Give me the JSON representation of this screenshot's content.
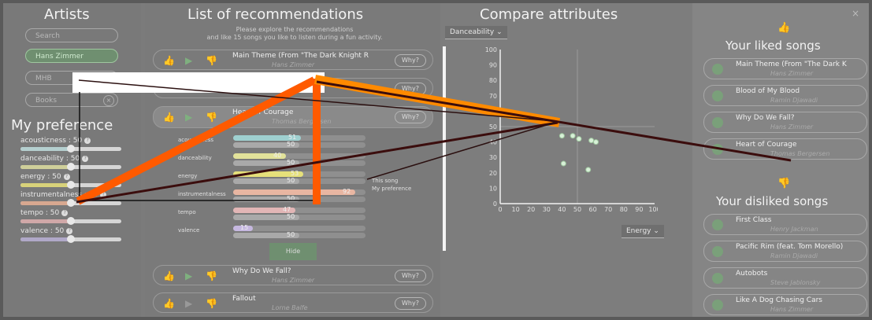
{
  "artists": {
    "title": "Artists",
    "search_placeholder": "Search",
    "items": [
      {
        "label": "Hans Zimmer",
        "selected": true
      },
      {
        "label": "MHB",
        "selected": false
      },
      {
        "label": "Books",
        "selected": false
      }
    ],
    "close_symbol": "×"
  },
  "preference": {
    "title": "My preference",
    "sliders": [
      {
        "label": "acousticness : 50",
        "value": 50,
        "color": "#b5cfcf"
      },
      {
        "label": "danceability : 50",
        "value": 50,
        "color": "#cfcf9a"
      },
      {
        "label": "energy : 50",
        "value": 50,
        "color": "#d8d27a"
      },
      {
        "label": "instrumentalness : 50",
        "value": 50,
        "color": "#d8a890"
      },
      {
        "label": "tempo : 50",
        "value": 50,
        "color": "#d0a8a8"
      },
      {
        "label": "valence : 50",
        "value": 50,
        "color": "#b0a8c8"
      }
    ],
    "help_symbol": "?"
  },
  "recommendations": {
    "title": "List of recommendations",
    "instructions_line1": "Please explore the recommendations",
    "instructions_line2": "and like 15 songs you like to listen during a fun activity.",
    "why_label": "Why?",
    "hide_label": "Hide",
    "songs": [
      {
        "title": "Main Theme (From \"The Dark Knight R",
        "artist": "Hans Zimmer"
      },
      {
        "title": "",
        "artist": ""
      },
      {
        "title": "Heart of Courage",
        "artist": "Thomas Bergersen"
      },
      {
        "title": "Why Do We Fall?",
        "artist": "Hans Zimmer"
      },
      {
        "title": "Fallout",
        "artist": "Lorne Balfe"
      }
    ],
    "detail_rows": [
      {
        "label": "acousticness",
        "song": 51,
        "pref": 50,
        "color": "#9fd0d0"
      },
      {
        "label": "danceability",
        "song": 40,
        "pref": 50,
        "color": "#e2e29a"
      },
      {
        "label": "energy",
        "song": 53,
        "pref": 50,
        "color": "#e6e07a"
      },
      {
        "label": "instrumentalness",
        "song": 92,
        "pref": 50,
        "color": "#e8b6a2"
      },
      {
        "label": "tempo",
        "song": 47,
        "pref": 50,
        "color": "#e2b6b6"
      },
      {
        "label": "valence",
        "song": 15,
        "pref": 50,
        "color": "#c6b8e0"
      }
    ],
    "legend_song": "This song",
    "legend_pref": "My preference"
  },
  "compare": {
    "title": "Compare attributes",
    "y_select": "Danceability",
    "x_select": "Energy",
    "chevron": "⌄"
  },
  "liked": {
    "title": "Your liked songs",
    "songs": [
      {
        "title": "Main Theme (From \"The Dark K",
        "artist": "Hans Zimmer"
      },
      {
        "title": "Blood of My Blood",
        "artist": "Ramin Djawadi"
      },
      {
        "title": "Why Do We Fall?",
        "artist": "Hans Zimmer"
      },
      {
        "title": "Heart of Courage",
        "artist": "Thomas Bergersen"
      }
    ]
  },
  "disliked": {
    "title": "Your disliked songs",
    "songs": [
      {
        "title": "First Class",
        "artist": "Henry Jackman"
      },
      {
        "title": "Pacific Rim (feat. Tom Morello)",
        "artist": "Ramin Djawadi"
      },
      {
        "title": "Autobots",
        "artist": "Steve Jablonsky"
      },
      {
        "title": "Like A Dog Chasing Cars",
        "artist": "Hans Zimmer"
      }
    ]
  },
  "close_panel_symbol": "×",
  "colors": {
    "accent_green": "#7fb07f",
    "overlay_orange": "#ff5a00",
    "overlay_dark": "#3b0d0d"
  },
  "chart_data": {
    "type": "scatter",
    "xlabel": "Energy",
    "ylabel": "Danceability",
    "xlim": [
      0,
      100
    ],
    "ylim": [
      0,
      100
    ],
    "x_ticks": [
      "0",
      "10",
      "20",
      "30",
      "40",
      "50",
      "60",
      "70",
      "80",
      "90",
      "100"
    ],
    "y_ticks": [
      "0",
      "10",
      "20",
      "30",
      "40",
      "50",
      "60",
      "70",
      "80",
      "90",
      "100"
    ],
    "points": [
      {
        "x": 40,
        "y": 44
      },
      {
        "x": 47,
        "y": 44
      },
      {
        "x": 51,
        "y": 42
      },
      {
        "x": 59,
        "y": 41
      },
      {
        "x": 62,
        "y": 40
      },
      {
        "x": 41,
        "y": 26
      },
      {
        "x": 57,
        "y": 22
      }
    ]
  }
}
